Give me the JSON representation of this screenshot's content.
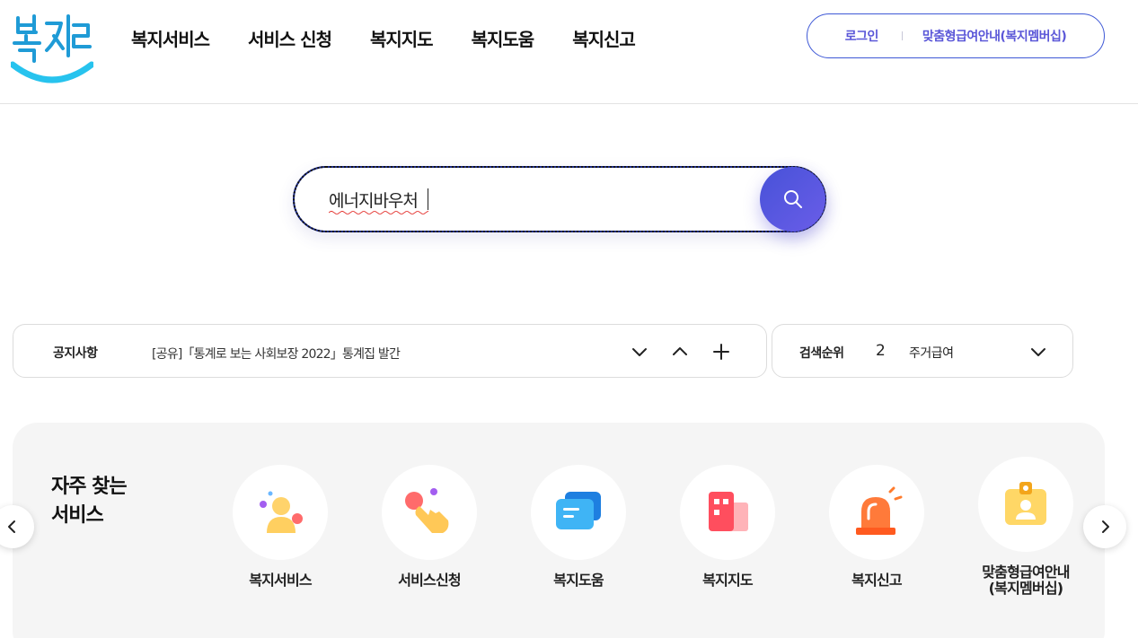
{
  "header": {
    "logo_text": "복지로",
    "nav": [
      "복지서비스",
      "서비스 신청",
      "복지지도",
      "복지도움",
      "복지신고"
    ],
    "login_label": "로그인",
    "membership_label": "맞춤형급여안내(복지멤버십)"
  },
  "search": {
    "value": "에너지바우처",
    "button_icon": "search-icon"
  },
  "notice": {
    "label": "공지사항",
    "text": "[공유]「통계로 보는 사회보장 2022」통계집 발간",
    "controls": [
      "chevron-down-icon",
      "chevron-up-icon",
      "plus-icon"
    ]
  },
  "rank": {
    "label": "검색순위",
    "number": "2",
    "keyword": "주거급여",
    "control": "chevron-down-icon"
  },
  "frequent": {
    "title_line1": "자주 찾는",
    "title_line2": "서비스",
    "items": [
      {
        "label": "복지서비스",
        "icon": "person-icon"
      },
      {
        "label": "서비스신청",
        "icon": "pointing-hand-icon"
      },
      {
        "label": "복지도움",
        "icon": "chat-bubble-icon"
      },
      {
        "label": "복지지도",
        "icon": "building-icon"
      },
      {
        "label": "복지신고",
        "icon": "siren-icon"
      },
      {
        "label_line1": "맞춤형급여안내",
        "label_line2": "(복지멤버십)",
        "icon": "id-badge-icon"
      }
    ]
  },
  "colors": {
    "accent": "#5b57d8",
    "border": "#3e58d6",
    "search_button": "#5658e0",
    "panel_bg": "#f5f5f5"
  }
}
